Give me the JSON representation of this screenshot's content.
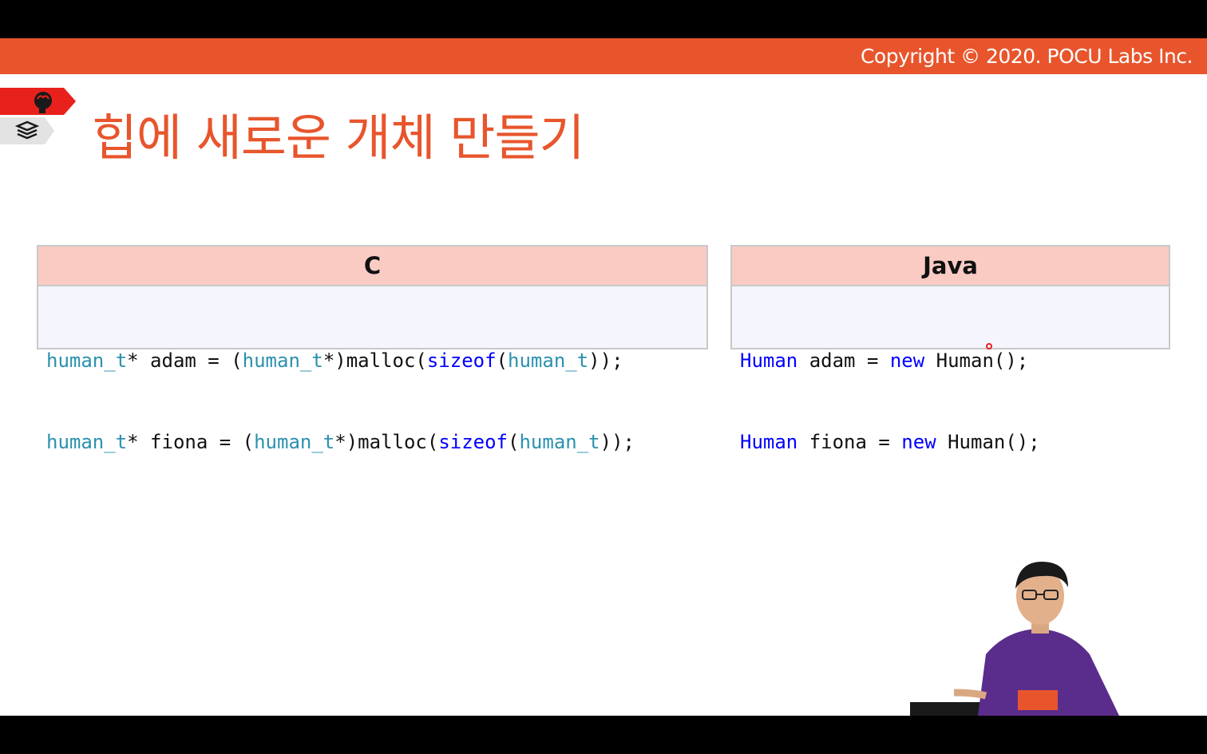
{
  "header": {
    "copyright": "Copyright © 2020. POCU Labs Inc."
  },
  "slide": {
    "title": "힙에 새로운 개체 만들기"
  },
  "c_panel": {
    "heading": "C",
    "line1": [
      {
        "t": "human_t",
        "c": "teal"
      },
      {
        "t": "* adam = (",
        "c": "plain"
      },
      {
        "t": "human_t",
        "c": "teal"
      },
      {
        "t": "*)malloc(",
        "c": "plain"
      },
      {
        "t": "sizeof",
        "c": "blue"
      },
      {
        "t": "(",
        "c": "plain"
      },
      {
        "t": "human_t",
        "c": "teal"
      },
      {
        "t": "));",
        "c": "plain"
      }
    ],
    "line2": [
      {
        "t": "human_t",
        "c": "teal"
      },
      {
        "t": "* fiona = (",
        "c": "plain"
      },
      {
        "t": "human_t",
        "c": "teal"
      },
      {
        "t": "*)malloc(",
        "c": "plain"
      },
      {
        "t": "sizeof",
        "c": "blue"
      },
      {
        "t": "(",
        "c": "plain"
      },
      {
        "t": "human_t",
        "c": "teal"
      },
      {
        "t": "));",
        "c": "plain"
      }
    ]
  },
  "java_panel": {
    "heading": "Java",
    "line1": [
      {
        "t": "Human",
        "c": "blue"
      },
      {
        "t": " adam = ",
        "c": "plain"
      },
      {
        "t": "new",
        "c": "blue"
      },
      {
        "t": " Human();",
        "c": "plain"
      }
    ],
    "line2": [
      {
        "t": "Human",
        "c": "blue"
      },
      {
        "t": " fiona = ",
        "c": "plain"
      },
      {
        "t": "new",
        "c": "blue"
      },
      {
        "t": " Human();",
        "c": "plain"
      }
    ]
  },
  "icons": {
    "badge_top": "brain-head-icon",
    "badge_bottom": "book-stack-icon"
  },
  "colors": {
    "accent": "#e8552c",
    "header_fill": "#f9cbc3",
    "code_bg": "#f5f5fd",
    "type_teal": "#2b91af",
    "keyword_blue": "#0000ff"
  }
}
